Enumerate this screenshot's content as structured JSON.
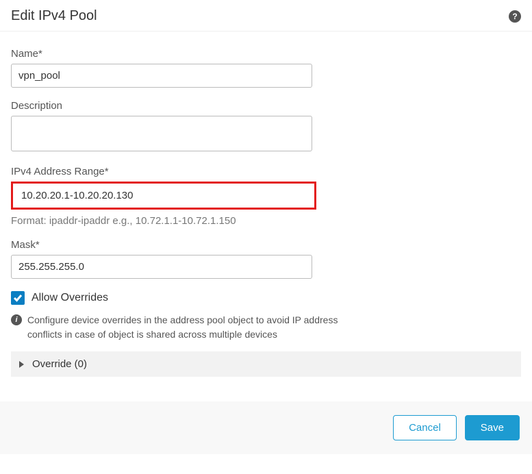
{
  "header": {
    "title": "Edit IPv4 Pool"
  },
  "form": {
    "name": {
      "label": "Name*",
      "value": "vpn_pool"
    },
    "description": {
      "label": "Description",
      "value": ""
    },
    "range": {
      "label": "IPv4 Address Range*",
      "value": "10.20.20.1-10.20.20.130",
      "hint": "Format: ipaddr-ipaddr e.g., 10.72.1.1-10.72.1.150"
    },
    "mask": {
      "label": "Mask*",
      "value": "255.255.255.0"
    },
    "allow_overrides": {
      "label": "Allow Overrides",
      "checked": true,
      "info": "Configure device overrides in the address pool object to avoid IP address conflicts in case of object is shared across multiple devices"
    },
    "override_section": {
      "label": "Override (0)"
    }
  },
  "footer": {
    "cancel": "Cancel",
    "save": "Save"
  }
}
